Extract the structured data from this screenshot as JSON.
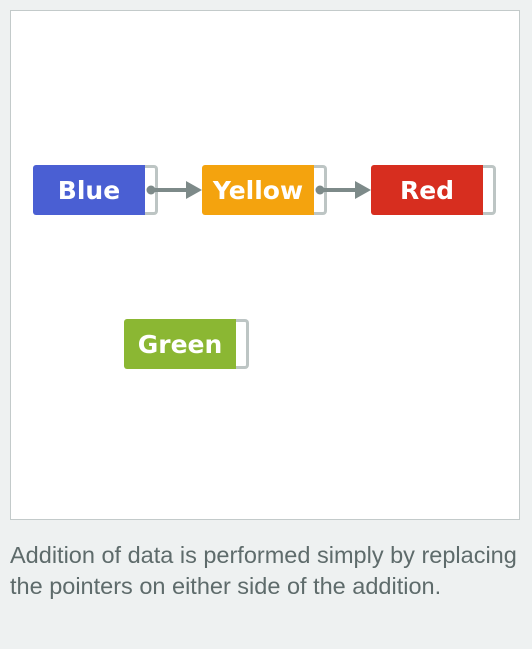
{
  "nodes": {
    "blue": {
      "label": "Blue",
      "color": "#4a5fd3"
    },
    "yellow": {
      "label": "Yellow",
      "color": "#f4a30e"
    },
    "red": {
      "label": "Red",
      "color": "#d72e1f"
    },
    "green": {
      "label": "Green",
      "color": "#8bb733"
    }
  },
  "colors": {
    "pointer_border": "#bdc5c4",
    "arrow": "#7d8a89",
    "caption_text": "#5e6b6b"
  },
  "caption": "Addition of data is performed simply by replacing the pointers on either side of the addition."
}
